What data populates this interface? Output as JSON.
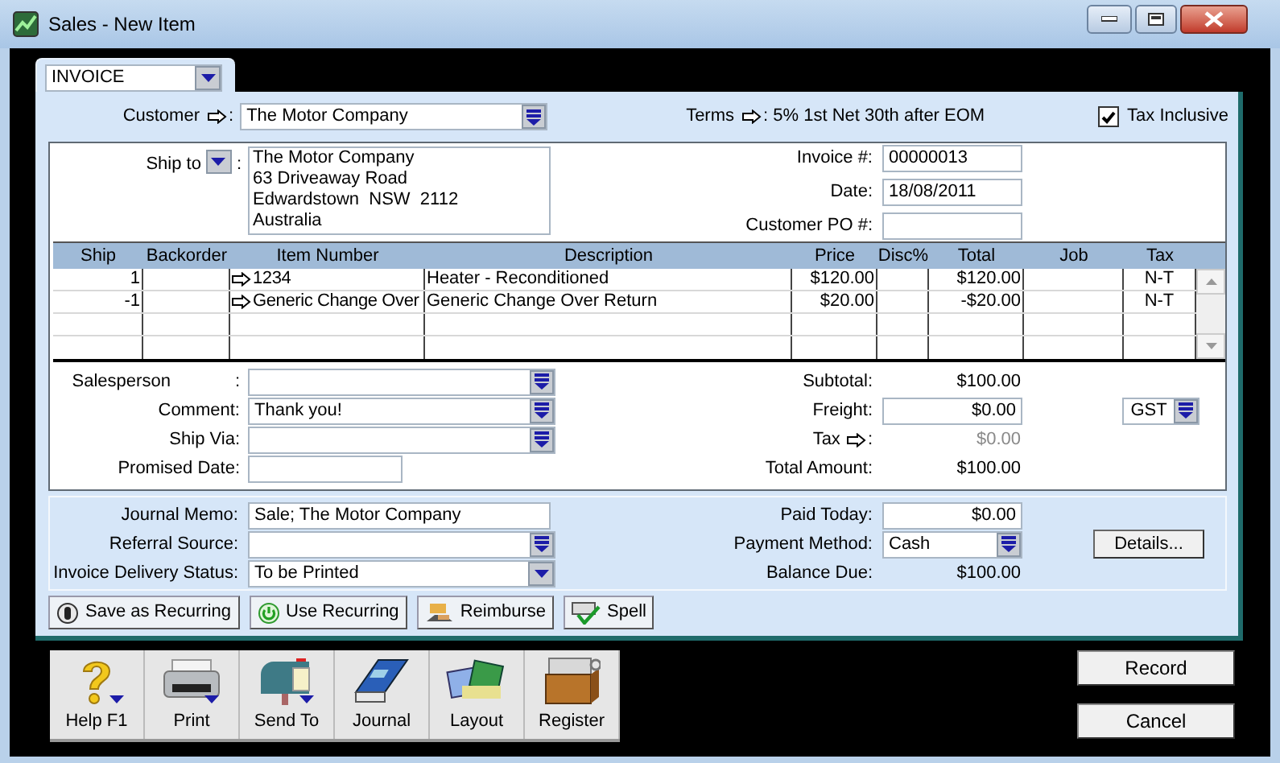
{
  "window": {
    "title": "Sales - New Item"
  },
  "form_type": "INVOICE",
  "customer": {
    "label": "Customer",
    "suffix": ":",
    "value": "The Motor Company"
  },
  "terms": {
    "label": "Terms",
    "suffix": ":",
    "value": "5% 1st Net 30th after EOM"
  },
  "tax_inclusive": {
    "label": "Tax Inclusive",
    "checked": true
  },
  "ship_to": {
    "label": "Ship to",
    "suffix": ":",
    "lines": [
      "The Motor Company",
      "63 Driveaway Road",
      "Edwardstown  NSW  2112",
      "Australia"
    ]
  },
  "header_fields": [
    {
      "label": "Invoice #:",
      "value": "00000013"
    },
    {
      "label": "Date:",
      "value": "18/08/2011"
    },
    {
      "label": "Customer PO #:"
    }
  ],
  "table": {
    "columns": [
      "Ship",
      "Backorder",
      "Item Number",
      "Description",
      "Price",
      "Disc%",
      "Total",
      "Job",
      "Tax"
    ],
    "rows": [
      {
        "ship": "1",
        "item_number": "1234",
        "description": "Heater - Reconditioned",
        "price": "$120.00",
        "total": "$120.00",
        "tax": "N-T"
      },
      {
        "ship": "-1",
        "item_number": "Generic Change Over",
        "description": "Generic Change Over Return",
        "price": "$20.00",
        "total": "-$20.00",
        "tax": "N-T"
      }
    ]
  },
  "detail_fields": [
    {
      "label": "Salesperson",
      "suffix": ":",
      "kind": "dropdown"
    },
    {
      "label": "Comment:",
      "value": "Thank you!",
      "kind": "dropdown"
    },
    {
      "label": "Ship Via:",
      "kind": "dropdown"
    },
    {
      "label": "Promised Date:",
      "kind": "short"
    }
  ],
  "totals": [
    {
      "label": "Subtotal:",
      "value": "$100.00",
      "kind": "text",
      "disabled": false
    },
    {
      "label": "Freight:",
      "value": "$0.00",
      "kind": "field",
      "disabled": false
    },
    {
      "label": "Tax",
      "suffix": ":",
      "value": "$0.00",
      "kind": "link",
      "disabled": true
    },
    {
      "label": "Total Amount:",
      "value": "$100.00",
      "kind": "text",
      "disabled": false
    }
  ],
  "tax_code": "GST",
  "memo_fields": [
    {
      "label": "Journal Memo:",
      "value": "Sale; The Motor Company",
      "kind": "text"
    },
    {
      "label": "Referral Source:",
      "kind": "dropdown"
    },
    {
      "label": "Invoice Delivery Status:",
      "value": "To be Printed",
      "kind": "select"
    }
  ],
  "payment_fields": [
    {
      "label": "Paid Today:",
      "value": "$0.00",
      "kind": "amount"
    },
    {
      "label": "Payment Method:",
      "value": "Cash",
      "kind": "dropdown"
    },
    {
      "label": "Balance Due:",
      "value": "$100.00",
      "kind": "text"
    }
  ],
  "details_button": "Details...",
  "action_buttons": [
    {
      "label": "Save as Recurring",
      "kind": "save"
    },
    {
      "label": "Use Recurring",
      "kind": "use"
    },
    {
      "label": "Reimburse",
      "kind": "reimburse"
    },
    {
      "label": "Spell",
      "kind": "spell"
    }
  ],
  "toolbar": [
    {
      "label": "Help F1",
      "kind": "help",
      "menu": true
    },
    {
      "label": "Print",
      "kind": "print",
      "menu": true
    },
    {
      "label": "Send To",
      "kind": "send",
      "menu": true
    },
    {
      "label": "Journal",
      "kind": "journal",
      "menu": false
    },
    {
      "label": "Layout",
      "kind": "layout",
      "menu": false
    },
    {
      "label": "Register",
      "kind": "register",
      "menu": false
    }
  ],
  "dialog_buttons": [
    "Record",
    "Cancel"
  ]
}
